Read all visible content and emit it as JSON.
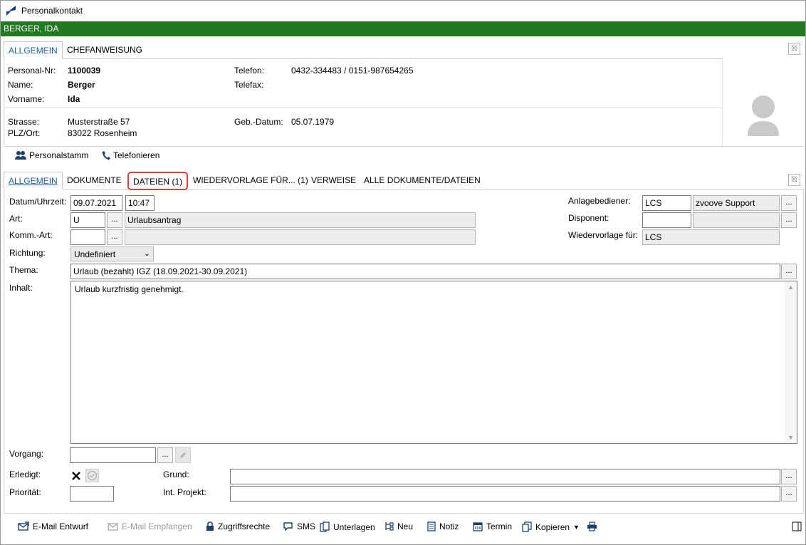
{
  "window": {
    "title": "Personalkontakt",
    "person_header": "BERGER, IDA"
  },
  "top_tabs": [
    {
      "label": "ALLGEMEIN",
      "active": true
    },
    {
      "label": "CHEFANWEISUNG",
      "active": false
    }
  ],
  "person": {
    "personal_nr_label": "Personal-Nr:",
    "personal_nr": "1100039",
    "name_label": "Name:",
    "name": "Berger",
    "vorname_label": "Vorname:",
    "vorname": "Ida",
    "strasse_label": "Strasse:",
    "strasse": "Musterstraße 57",
    "plz_label": "PLZ/Ort:",
    "plz_ort": "83022 Rosenheim",
    "telefon_label": "Telefon:",
    "telefon": "0432-334483 / 0151-987654265",
    "telefax_label": "Telefax:",
    "telefax": "",
    "geb_label": "Geb.-Datum:",
    "geb_datum": "05.07.1979"
  },
  "actions": {
    "personalstamm": "Personalstamm",
    "telefonieren": "Telefonieren"
  },
  "detail_tabs": [
    {
      "label": "ALLGEMEIN",
      "active": true
    },
    {
      "label": "DOKUMENTE",
      "active": false
    },
    {
      "label": "DATEIEN (1)",
      "active": false,
      "highlighted": true
    },
    {
      "label": "WIEDERVORLAGE FÜR... (1)",
      "active": false
    },
    {
      "label": "VERWEISE",
      "active": false
    },
    {
      "label": "ALLE DOKUMENTE/DATEIEN",
      "active": false
    }
  ],
  "form": {
    "datum_label": "Datum/Uhrzeit:",
    "datum": "09.07.2021",
    "uhrzeit": "10:47",
    "art_label": "Art:",
    "art_code": "U",
    "art_text": "Urlaubsantrag",
    "komm_label": "Komm.-Art:",
    "komm_code": "",
    "komm_text": "",
    "richtung_label": "Richtung:",
    "richtung": "Undefiniert",
    "thema_label": "Thema:",
    "thema": "Urlaub (bezahlt) IGZ (18.09.2021-30.09.2021)",
    "inhalt_label": "Inhalt:",
    "inhalt": "Urlaub kurzfristig genehmigt.",
    "anlage_label": "Anlagebediener:",
    "anlage_code": "LCS",
    "anlage_name": "zvoove Support",
    "disponent_label": "Disponent:",
    "disponent_code": "",
    "disponent_name": "",
    "wiedervorlage_label": "Wiedervorlage für:",
    "wiedervorlage": "LCS",
    "vorgang_label": "Vorgang:",
    "vorgang": "",
    "erledigt_label": "Erledigt:",
    "prioritaet_label": "Priorität:",
    "prioritaet": "",
    "grund_label": "Grund:",
    "grund": "",
    "projekt_label": "Int. Projekt:",
    "projekt": "",
    "dots": "..."
  },
  "bottom_actions": [
    {
      "label": "E-Mail Entwurf",
      "icon": "email-draft-icon",
      "enabled": true
    },
    {
      "label": "E-Mail Empfangen",
      "icon": "email-receive-icon",
      "enabled": false
    },
    {
      "label": "Zugriffsrechte",
      "icon": "lock-icon",
      "enabled": true
    },
    {
      "label": "SMS",
      "icon": "sms-icon",
      "enabled": true
    },
    {
      "label": "Unterlagen",
      "icon": "documents-icon",
      "enabled": true
    },
    {
      "label": "Neu",
      "icon": "new-icon",
      "enabled": true
    },
    {
      "label": "Notiz",
      "icon": "note-icon",
      "enabled": true
    },
    {
      "label": "Termin",
      "icon": "calendar-icon",
      "enabled": true
    },
    {
      "label": "Kopieren",
      "icon": "copy-icon",
      "enabled": true
    }
  ],
  "colors": {
    "header_green": "#217a21",
    "accent_blue": "#1f5fa8",
    "highlight_red": "#e04040"
  }
}
